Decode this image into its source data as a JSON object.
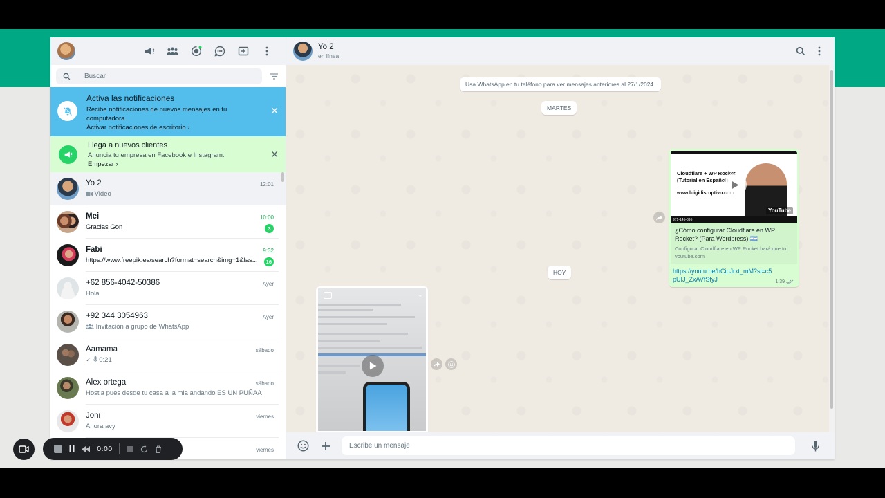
{
  "sidebar": {
    "search_placeholder": "Buscar",
    "notification": {
      "title": "Activa las notificaciones",
      "description": "Recibe notificaciones de nuevos mensajes en tu computadora.",
      "link": "Activar notificaciones de escritorio ›"
    },
    "promo": {
      "title": "Llega a nuevos clientes",
      "description": "Anuncia tu empresa en Facebook e Instagram.",
      "link": "Empezar ›"
    },
    "chats": [
      {
        "name": "Yo 2",
        "message": "Video",
        "time": "12:01"
      },
      {
        "name": "Mei",
        "message": "Gracias Gon",
        "time": "10:00",
        "badge": "3"
      },
      {
        "name": "Fabi",
        "message": "https://www.freepik.es/search?format=search&img=1&las...",
        "time": "9:32",
        "badge": "16"
      },
      {
        "name": "+62 856-4042-50386",
        "message": "Hola",
        "time": "Ayer"
      },
      {
        "name": "+92 344 3054963",
        "message": "Invitación a grupo de WhatsApp",
        "time": "Ayer"
      },
      {
        "name": "Aamama",
        "message": "0:21",
        "time": "sábado"
      },
      {
        "name": "Alex ortega",
        "message": "Hostia pues desde tu casa a la mia andando ES UN PUÑAAAO...",
        "time": "sábado"
      },
      {
        "name": "Joni",
        "message": "Ahora avy",
        "time": "viernes"
      },
      {
        "name": "",
        "message": "",
        "time": "viernes"
      }
    ]
  },
  "chat": {
    "name": "Yo 2",
    "status": "en línea",
    "system_notice": "Usa WhatsApp en tu teléfono para ver mensajes anteriores al 27/1/2024.",
    "day_labels": [
      "MARTES",
      "HOY"
    ],
    "link_message": {
      "thumb_title": "Cloudflare + WP Rocket (Tutorial en Español)",
      "thumb_site": "www.luigidisruptivo.com",
      "thumb_phone": "971-145-895",
      "thumb_brand": "YouTube",
      "preview_title": "¿Cómo configurar Cloudflare en WP Rocket? (Para Wordpress) 🇦🇷",
      "preview_desc": "Configurar Cloudflare en WP Rocket hará que tu",
      "preview_domain": "youtube.com",
      "url": "https://youtu.be/hCipJrxt_mM?si=c5pUIJ_ZxAVfSfyJ",
      "time": "1:39"
    },
    "composer_placeholder": "Escribe un mensaje"
  },
  "recorder": {
    "time": "0:00"
  },
  "colors": {
    "brand_green": "#00a884",
    "notif_blue": "#53bdeb",
    "promo_bg": "#d9fdd3",
    "badge_green": "#25d366",
    "outgoing_bubble": "#d9fdd3"
  }
}
